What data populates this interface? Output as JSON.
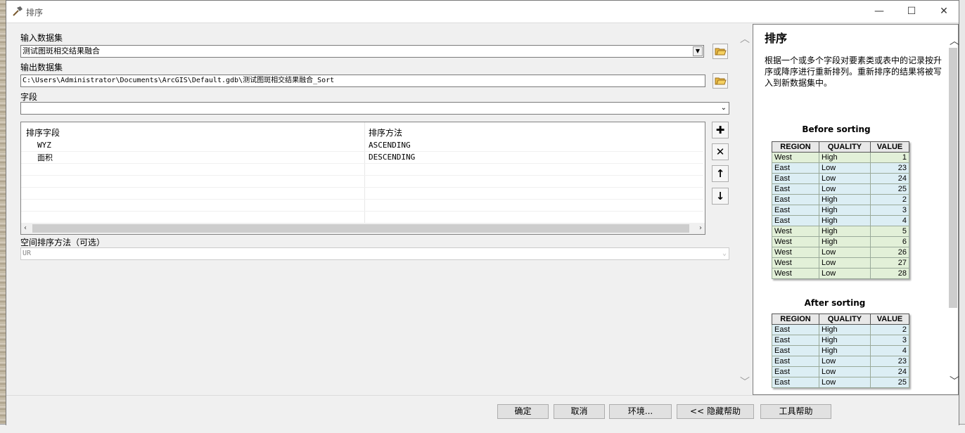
{
  "window": {
    "title": "排序"
  },
  "input_dataset": {
    "label": "输入数据集",
    "value": "测试图斑相交结果融合"
  },
  "output_dataset": {
    "label": "输出数据集",
    "value": "C:\\Users\\Administrator\\Documents\\ArcGIS\\Default.gdb\\测试图斑相交结果融合_Sort"
  },
  "field": {
    "label": "字段",
    "value": ""
  },
  "sort_table": {
    "headers": [
      "排序字段",
      "排序方法"
    ],
    "rows": [
      {
        "field": "WYZ",
        "method": "ASCENDING"
      },
      {
        "field": "面积",
        "method": "DESCENDING"
      }
    ]
  },
  "spatial_sort": {
    "label": "空间排序方法（可选）",
    "value": "UR"
  },
  "buttons": {
    "ok": "确定",
    "cancel": "取消",
    "env": "环境...",
    "hide_help": "<< 隐藏帮助",
    "tool_help": "工具帮助"
  },
  "help": {
    "title": "排序",
    "description": "根据一个或多个字段对要素类或表中的记录按升序或降序进行重新排列。重新排序的结果将被写入到新数据集中。",
    "before_caption": "Before sorting",
    "after_caption": "After sorting",
    "columns": [
      "REGION",
      "QUALITY",
      "VALUE"
    ],
    "before_rows": [
      [
        "West",
        "High",
        "1"
      ],
      [
        "East",
        "Low",
        "23"
      ],
      [
        "East",
        "Low",
        "24"
      ],
      [
        "East",
        "Low",
        "25"
      ],
      [
        "East",
        "High",
        "2"
      ],
      [
        "East",
        "High",
        "3"
      ],
      [
        "East",
        "High",
        "4"
      ],
      [
        "West",
        "High",
        "5"
      ],
      [
        "West",
        "High",
        "6"
      ],
      [
        "West",
        "Low",
        "26"
      ],
      [
        "West",
        "Low",
        "27"
      ],
      [
        "West",
        "Low",
        "28"
      ]
    ],
    "after_rows": [
      [
        "East",
        "High",
        "2"
      ],
      [
        "East",
        "High",
        "3"
      ],
      [
        "East",
        "High",
        "4"
      ],
      [
        "East",
        "Low",
        "23"
      ],
      [
        "East",
        "Low",
        "24"
      ],
      [
        "East",
        "Low",
        "25"
      ]
    ]
  },
  "colors": {
    "west_row": "#e2f0d8",
    "east_row": "#dceef4"
  }
}
